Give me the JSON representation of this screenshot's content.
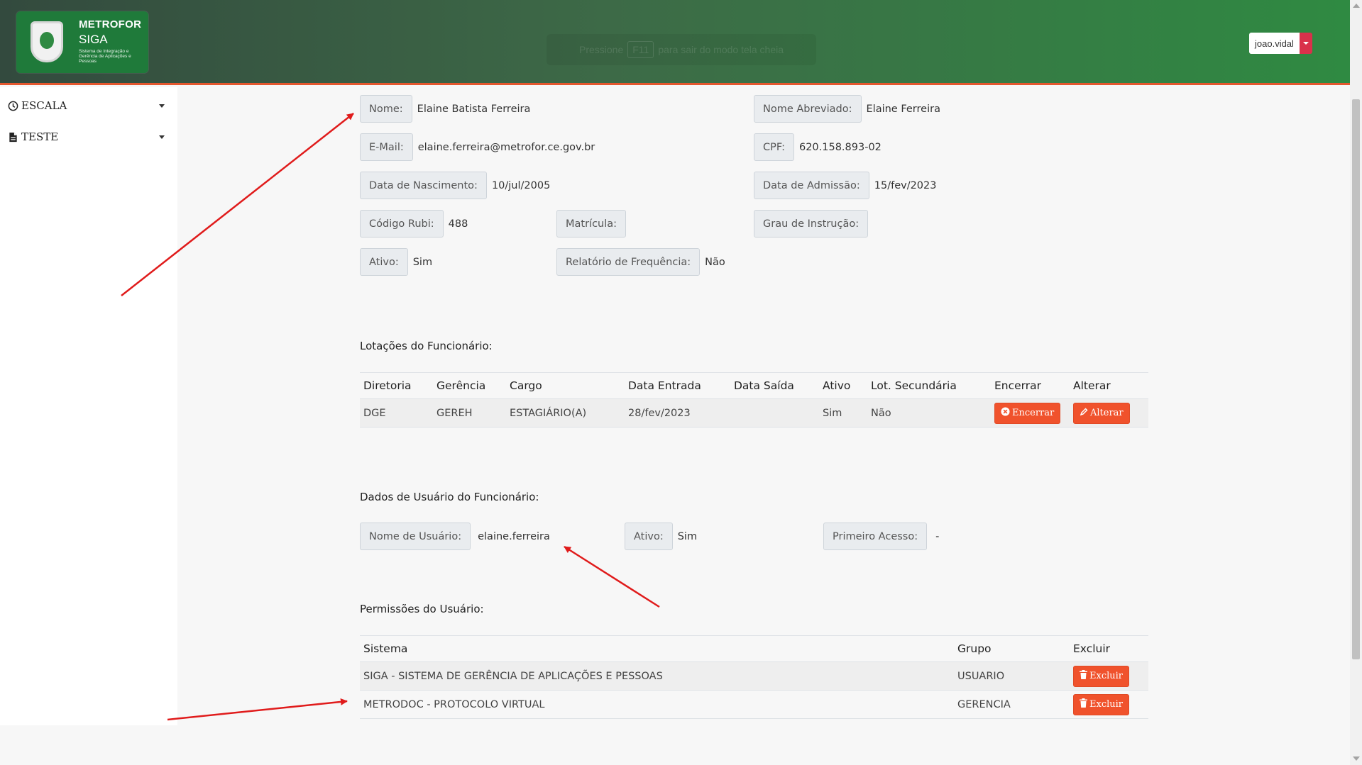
{
  "header": {
    "logo": {
      "title": "METROFOR",
      "subtitle": "SIGA",
      "description": "Sistema de Integração e Gerência de Aplicações e Pessoas"
    },
    "fullscreen_hint": {
      "before": "Pressione",
      "key": "F11",
      "after": "para sair do modo tela cheia"
    },
    "user": {
      "name": "joao.vidal"
    }
  },
  "sidebar": {
    "items": [
      {
        "label": "ESCALA",
        "icon": "clock-icon"
      },
      {
        "label": "TESTE",
        "icon": "document-icon"
      }
    ]
  },
  "employee": {
    "nome_label": "Nome:",
    "nome": "Elaine Batista Ferreira",
    "nome_abreviado_label": "Nome Abreviado:",
    "nome_abreviado": "Elaine Ferreira",
    "email_label": "E-Mail:",
    "email": "elaine.ferreira@metrofor.ce.gov.br",
    "cpf_label": "CPF:",
    "cpf": "620.158.893-02",
    "nascimento_label": "Data de Nascimento:",
    "nascimento": "10/jul/2005",
    "admissao_label": "Data de Admissão:",
    "admissao": "15/fev/2023",
    "codigo_rubi_label": "Código Rubi:",
    "codigo_rubi": "488",
    "matricula_label": "Matrícula:",
    "matricula": "",
    "grau_instrucao_label": "Grau de Instrução:",
    "grau_instrucao": "",
    "ativo_label": "Ativo:",
    "ativo": "Sim",
    "relatorio_label": "Relatório de Frequência:",
    "relatorio": "Não"
  },
  "lotacoes": {
    "title": "Lotações do Funcionário:",
    "columns": [
      "Diretoria",
      "Gerência",
      "Cargo",
      "Data Entrada",
      "Data Saída",
      "Ativo",
      "Lot. Secundária",
      "Encerrar",
      "Alterar"
    ],
    "rows": [
      {
        "diretoria": "DGE",
        "gerencia": "GEREH",
        "cargo": "ESTAGIÁRIO(A)",
        "data_entrada": "28/fev/2023",
        "data_saida": "",
        "ativo": "Sim",
        "lot_secundaria": "Não"
      }
    ],
    "encerrar_label": "Encerrar",
    "alterar_label": "Alterar"
  },
  "usuario": {
    "title": "Dados de Usuário do Funcionário:",
    "nome_usuario_label": "Nome de Usuário:",
    "nome_usuario": "elaine.ferreira",
    "ativo_label": "Ativo:",
    "ativo": "Sim",
    "primeiro_acesso_label": "Primeiro Acesso:",
    "primeiro_acesso": "-"
  },
  "permissoes": {
    "title": "Permissões do Usuário:",
    "columns": [
      "Sistema",
      "Grupo",
      "Excluir"
    ],
    "rows": [
      {
        "sistema": "SIGA - SISTEMA DE GERÊNCIA DE APLICAÇÕES E PESSOAS",
        "grupo": "USUARIO"
      },
      {
        "sistema": "METRODOC - PROTOCOLO VIRTUAL",
        "grupo": "GERENCIA"
      }
    ],
    "excluir_label": "Excluir"
  },
  "colors": {
    "header_green": "#2f8a42",
    "accent_orange": "#f0522c",
    "annotation_red": "#e01b1b",
    "user_toggle": "#d9314b"
  }
}
